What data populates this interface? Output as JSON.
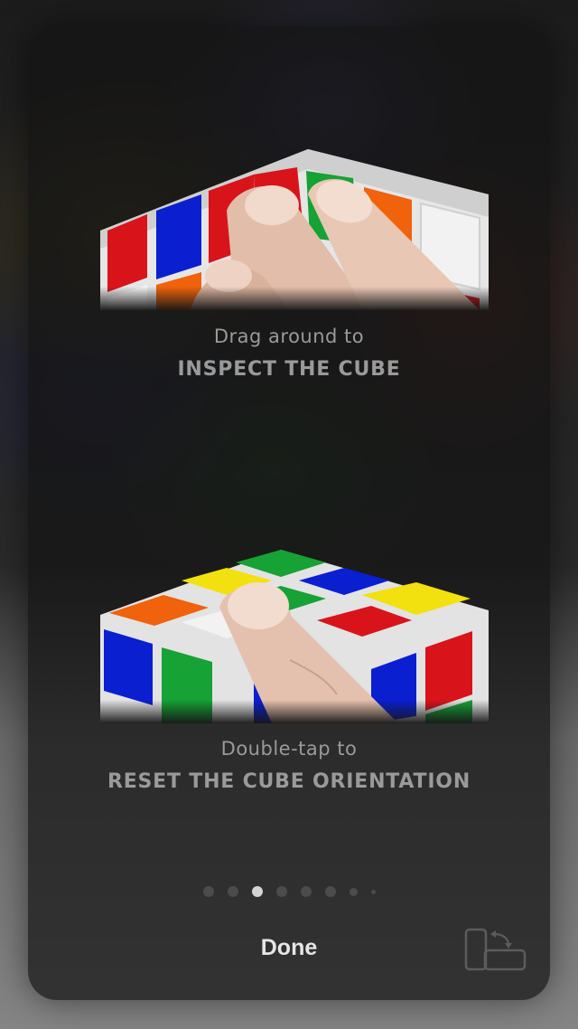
{
  "onboarding": {
    "step1": {
      "subtitle": "Drag around to",
      "title": "INSPECT THE CUBE"
    },
    "step2": {
      "subtitle": "Double-tap to",
      "title": "RESET THE CUBE ORIENTATION"
    }
  },
  "pagination": {
    "page_count": 8,
    "current_page": 3
  },
  "footer": {
    "done_label": "Done",
    "rotate_icon": "rotate-device-icon"
  },
  "colors": {
    "red": "#d8141a",
    "blue": "#0a1fd0",
    "green": "#16a235",
    "orange": "#f0620c",
    "yellow": "#f2e10e",
    "white": "#f2f2f2",
    "skin": "#e8c7b4"
  }
}
